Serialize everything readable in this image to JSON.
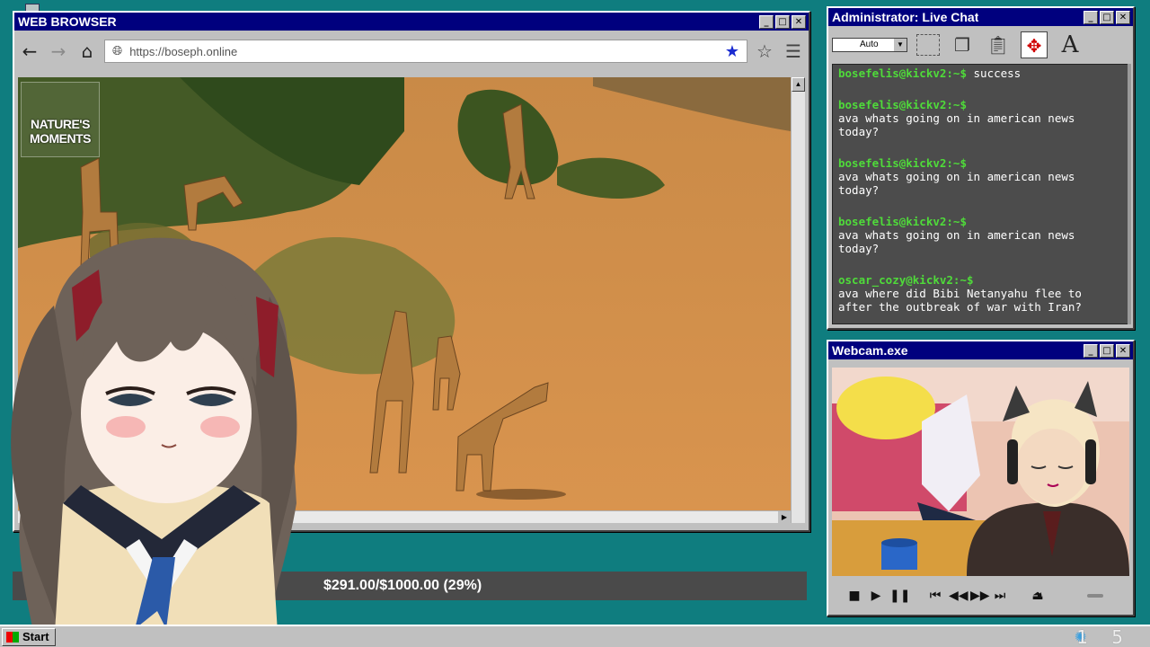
{
  "browser": {
    "title": "WEB BROWSER",
    "url": "https://boseph.online",
    "video_logo_line1": "NATURE'S",
    "video_logo_line2": "MOMENTS"
  },
  "donation": {
    "text": "$291.00/$1000.00 (29%)",
    "progress": 0.29
  },
  "chat": {
    "title": "Administrator: Live Chat",
    "font_select": "Auto",
    "messages": [
      {
        "user": "bosefelis@kickv2:~$",
        "text": "success",
        "inline": true
      },
      {
        "user": "bosefelis@kickv2:~$",
        "text": "ava whats going on in american news today?",
        "inline": false
      },
      {
        "user": "bosefelis@kickv2:~$",
        "text": "ava whats going on in american news today?",
        "inline": false
      },
      {
        "user": "bosefelis@kickv2:~$",
        "text": "ava whats going on in american news today?",
        "inline": false
      },
      {
        "user": "oscar_cozy@kickv2:~$",
        "text": "ava where did Bibi Netanyahu flee to after the outbreak of war with Iran?",
        "inline": false
      }
    ]
  },
  "webcam": {
    "title": "Webcam.exe"
  },
  "taskbar": {
    "start_label": "Start",
    "clock": "1 5"
  },
  "colors": {
    "desktop": "#0f7d7f",
    "titlebar": "#00007e",
    "chat_user": "#4fdb3a"
  }
}
